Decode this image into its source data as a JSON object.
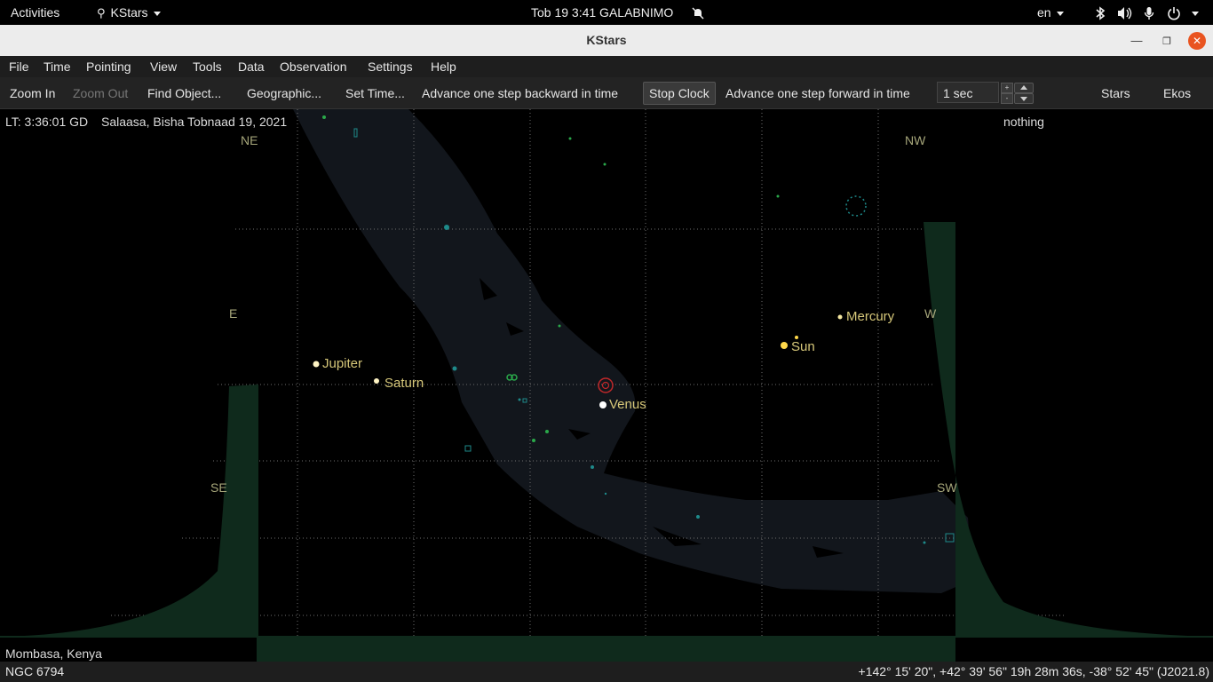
{
  "topbar": {
    "activities": "Activities",
    "app_name": "KStars",
    "clock": "Tob 19   3:41 GALABNIMO",
    "language": "en"
  },
  "window": {
    "title": "KStars"
  },
  "menubar": [
    "File",
    "Time",
    "Pointing",
    "View",
    "Tools",
    "Data",
    "Observation",
    "Settings",
    "Help"
  ],
  "toolbar": {
    "zoom_in": "Zoom In",
    "zoom_out": "Zoom Out",
    "find_object": "Find Object...",
    "geographic": "Geographic...",
    "set_time": "Set Time...",
    "step_back": "Advance one step backward in time",
    "stop_clock": "Stop Clock",
    "step_forward": "Advance one step forward in time",
    "step_value": "1 sec",
    "stars": "Stars",
    "ekos": "Ekos"
  },
  "skymap": {
    "local_time": "LT: 3:36:01 GD",
    "date": "Salaasa, Bisha Tobnaad 19, 2021",
    "focus_object": "nothing",
    "location": "Mombasa, Kenya",
    "compass": {
      "ne": "NE",
      "nw": "NW",
      "e": "E",
      "w": "W",
      "se": "SE",
      "sw": "SW"
    },
    "planets": {
      "mercury": "Mercury",
      "sun": "Sun",
      "jupiter": "Jupiter",
      "saturn": "Saturn",
      "venus": "Venus"
    },
    "colors": {
      "horizon_ground": "#0f2a1c",
      "milky_way": "#12161c",
      "grid": "#6e6e6e",
      "planet_label": "#d6c779",
      "compass_label": "#a6a67a"
    }
  },
  "statusbar": {
    "object_name": "NGC 6794",
    "coordinates": "+142° 15' 20\", +42° 39' 56\"  19h 28m 36s, -38° 52' 45\" (J2021.8)"
  }
}
